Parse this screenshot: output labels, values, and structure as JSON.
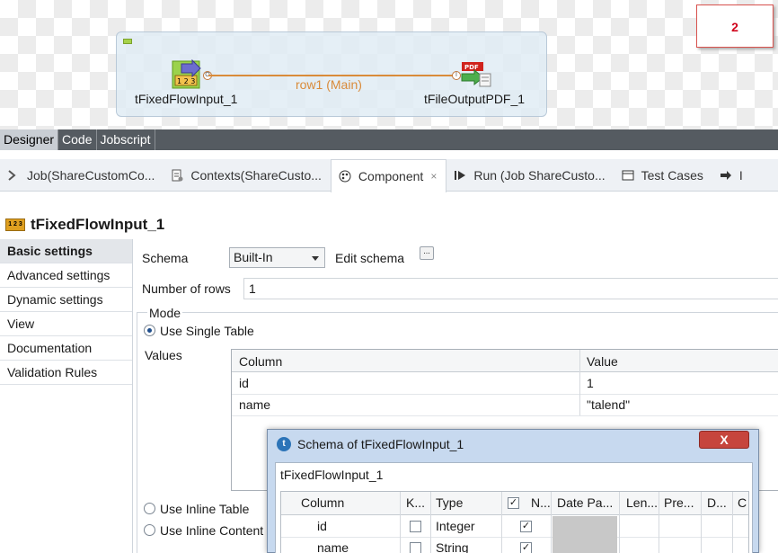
{
  "canvas": {
    "components": [
      {
        "label": "tFixedFlowInput_1",
        "icon": "fixed-flow-input-icon"
      },
      {
        "label": "tFileOutputPDF_1",
        "icon": "pdf-output-icon"
      }
    ],
    "link_label": "row1 (Main)",
    "note_text": "2",
    "connector_out": "O",
    "connector_in": "I"
  },
  "designer_tabs": [
    "Designer",
    "Code",
    "Jobscript"
  ],
  "view_tabs": [
    {
      "label": "Job(ShareCustomCo...",
      "icon": "job-icon"
    },
    {
      "label": "Contexts(ShareCusto...",
      "icon": "contexts-icon"
    },
    {
      "label": "Component",
      "icon": "component-icon",
      "active": true
    },
    {
      "label": "Run (Job ShareCusto...",
      "icon": "run-icon"
    },
    {
      "label": "Test Cases",
      "icon": "test-cases-icon"
    },
    {
      "label": "I",
      "icon": "more-icon"
    }
  ],
  "component_title": "tFixedFlowInput_1",
  "component_icon_text": "1 2 3",
  "settings_nav": [
    "Basic settings",
    "Advanced settings",
    "Dynamic settings",
    "View",
    "Documentation",
    "Validation Rules"
  ],
  "form": {
    "schema_label": "Schema",
    "schema_value": "Built-In",
    "edit_schema_label": "Edit schema",
    "edit_schema_button": "...",
    "rows_label": "Number of rows",
    "rows_value": "1",
    "mode_label": "Mode",
    "mode_single": "Use Single Table",
    "values_label": "Values",
    "mode_inline_table": "Use Inline Table",
    "mode_inline_content": "Use Inline Content"
  },
  "values_table": {
    "headers": [
      "Column",
      "Value"
    ],
    "rows": [
      [
        "id",
        "1"
      ],
      [
        "name",
        "\"talend\""
      ]
    ]
  },
  "dialog": {
    "title": "Schema of tFixedFlowInput_1",
    "close": "X",
    "subtitle": "tFixedFlowInput_1",
    "headers": [
      "Column",
      "K...",
      "Type",
      "N...",
      "Date Pa...",
      "Len...",
      "Pre...",
      "D...",
      "C"
    ],
    "rows": [
      {
        "column": "id",
        "key": false,
        "type": "Integer",
        "nullable": true
      },
      {
        "column": "name",
        "key": false,
        "type": "String",
        "nullable": true
      }
    ]
  }
}
